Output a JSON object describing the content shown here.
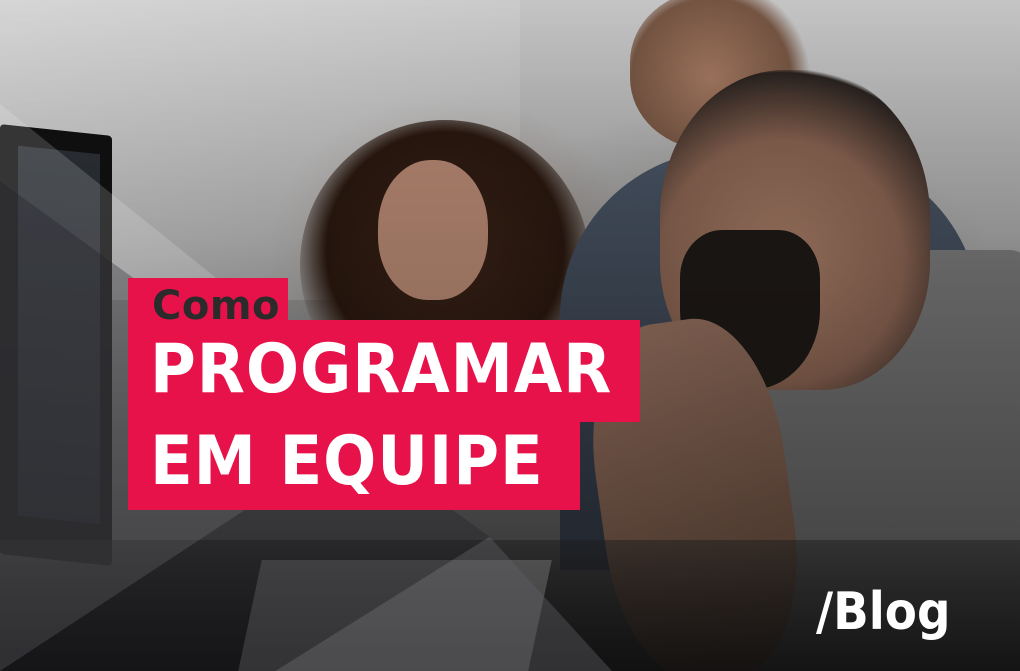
{
  "title": {
    "line1": "Como",
    "line2": "PROGRAMAR",
    "line3": "EM EQUIPE"
  },
  "tag": "/Blog",
  "colors": {
    "accent": "#e8124a",
    "title_dark_text": "#2b2b2b",
    "title_light_text": "#ffffff"
  }
}
